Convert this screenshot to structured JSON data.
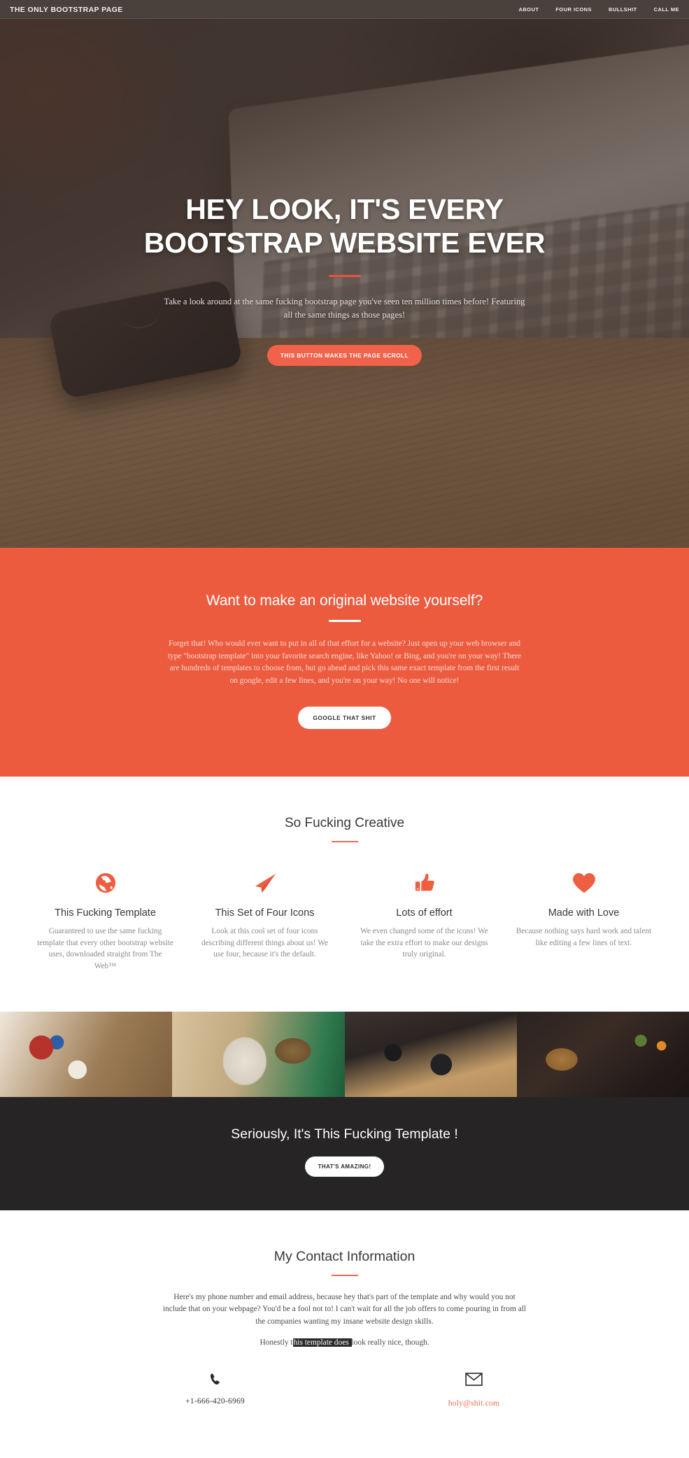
{
  "colors": {
    "accent": "#ed5b3f",
    "accent_button": "#f0624a",
    "nav_bg": "#4a403c",
    "dark_section": "#262424",
    "heading": "#3b3836",
    "muted_text": "#8e8a88",
    "mail_link": "#ec6a4c"
  },
  "nav": {
    "brand": "THE ONLY BOOTSTRAP PAGE",
    "links": [
      {
        "label": "ABOUT"
      },
      {
        "label": "FOUR ICONS"
      },
      {
        "label": "BULLSHIT"
      },
      {
        "label": "CALL ME"
      }
    ]
  },
  "hero": {
    "title": "HEY LOOK, IT'S EVERY BOOTSTRAP WEBSITE EVER",
    "subtitle": "Take a look around at the same fucking bootstrap page you've seen ten million times before! Featuring all the same things as those pages!",
    "button_label": "THIS BUTTON MAKES THE PAGE SCROLL"
  },
  "original": {
    "title": "Want to make an original website yourself?",
    "body": "Forget that! Who would ever want to put in all of that effort for a website? Just open up your web browser and type \"bootstrap template\" into your favorite search engine, like Yahoo! or Bing, and you're on your way! There are hundreds of templates to choose from, but go ahead and pick this same exact template from the first result on google, edit a few lines, and you're on your way! No one will notice!",
    "button_label": "GOOGLE THAT SHIT"
  },
  "features": {
    "title": "So Fucking Creative",
    "items": [
      {
        "icon": "globe-icon",
        "heading": "This Fucking Template",
        "text": "Guaranteed to use the same fucking template that every other bootstrap website uses, downloaded straight from The Web™"
      },
      {
        "icon": "paper-plane-icon",
        "heading": "This Set of Four Icons",
        "text": "Look at this cool set of four icons describing different things about us! We use four, because it's the default."
      },
      {
        "icon": "thumbs-up-icon",
        "heading": "Lots of effort",
        "text": "We even changed some of the icons! We take the extra effort to make our designs truly original."
      },
      {
        "icon": "heart-icon",
        "heading": "Made with Love",
        "text": "Because nothing says hard work and talent like editing a few lines of text."
      }
    ]
  },
  "gallery": {
    "items": [
      {
        "caption": "desk-flatlay-letterpress-photo"
      },
      {
        "caption": "notebook-dont-just-stand-there-photo"
      },
      {
        "caption": "vintage-cameras-photo"
      },
      {
        "caption": "dark-wood-spices-flatlay-photo"
      }
    ]
  },
  "dark_cta": {
    "title": "Seriously, It's This Fucking Template !",
    "button_label": "THAT'S AMAZING!"
  },
  "contact": {
    "title": "My Contact Information",
    "body": "Here's my phone number and email address, because hey that's part of the template and why would you not include that on your webpage? You'd be a fool not to! I can't wait for all the job offers to come pouring in from all the companies wanting my insane website design skills.",
    "note_before": "Honestly t",
    "note_highlight": "his template does ",
    "note_after": "look really nice, though.",
    "phone": "+1-666-420-6969",
    "email": "holy@shit.com"
  }
}
